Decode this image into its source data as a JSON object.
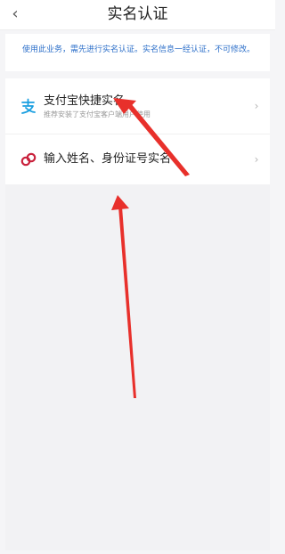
{
  "header": {
    "back_glyph": "‹",
    "title": "实名认证"
  },
  "notice": {
    "text": "使用此业务，需先进行实名认证。实名信息一经认证，不可修改。"
  },
  "options": [
    {
      "title": "支付宝快捷实名",
      "subtitle": "推荐安装了支付宝客户端用户使用",
      "icon": "alipay-icon"
    },
    {
      "title": "输入姓名、身份证号实名",
      "icon": "link-icon"
    }
  ],
  "chevron_glyph": "›",
  "colors": {
    "notice_text": "#2c6fc9",
    "alipay_blue": "#1a9fe0",
    "link_red": "#c9213c",
    "annotation_arrow": "#e8302b"
  },
  "annotation": {
    "type": "red-arrows",
    "count": 2
  }
}
